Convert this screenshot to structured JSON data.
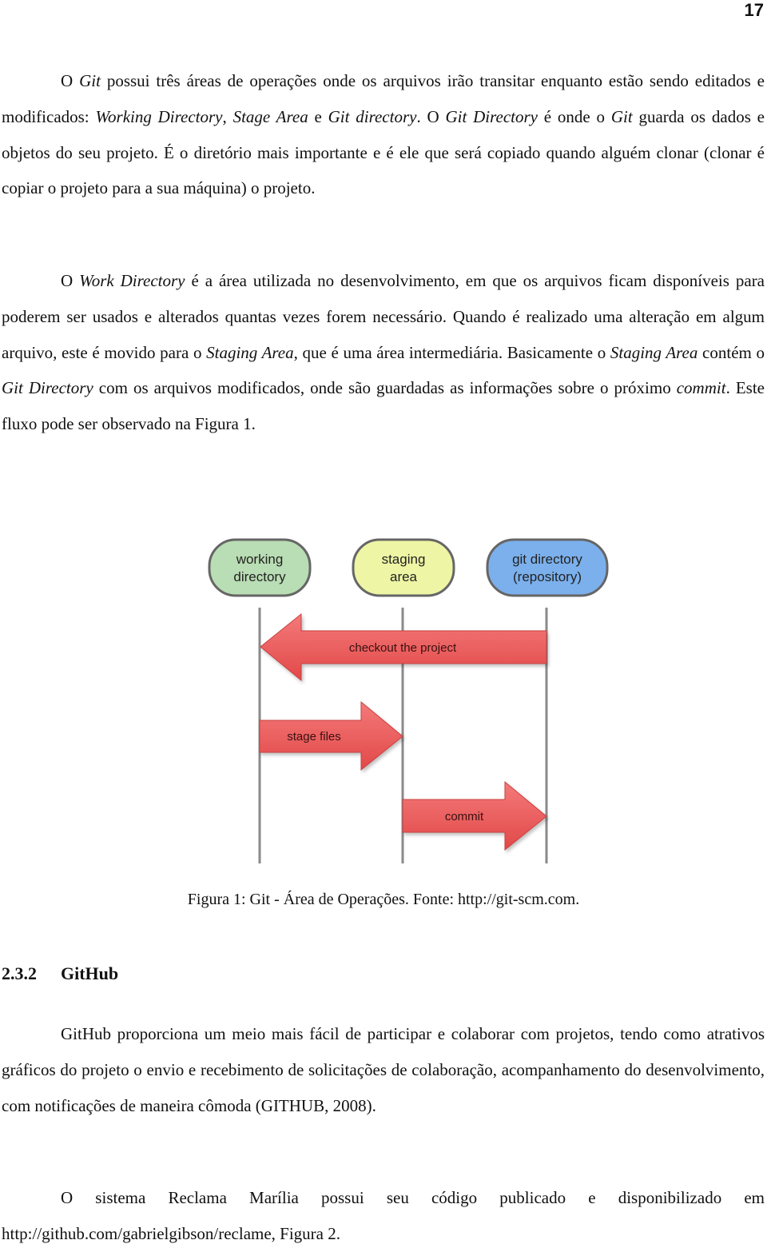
{
  "page": {
    "number": "17"
  },
  "paragraphs": {
    "p1": {
      "s1": "O ",
      "s2": "Git",
      "s3": " possui três áreas de operações onde os arquivos irão transitar enquanto estão sendo editados e modificados: ",
      "s4": "Working Directory",
      "s5": ", ",
      "s6": "Stage Area",
      "s7": " e ",
      "s8": "Git directory",
      "s9": ". O ",
      "s10": "Git Directory",
      "s11": " é onde o ",
      "s12": "Git",
      "s13": " guarda os dados e objetos do seu projeto. É o diretório mais importante e é ele que será copiado quando alguém clonar (clonar é copiar o projeto para a sua máquina) o projeto."
    },
    "p2": {
      "s1": "O ",
      "s2": "Work Directory",
      "s3": " é a área utilizada no desenvolvimento, em que os arquivos ficam disponíveis para poderem ser usados e alterados quantas vezes forem necessário. Quando é realizado uma alteração em algum arquivo, este é movido para o ",
      "s4": "Staging Area",
      "s5": ", que é uma área intermediária. Basicamente o ",
      "s6": "Staging Area",
      "s7": " contém o ",
      "s8": "Git Directory",
      "s9": " com os arquivos modificados, onde são guardadas as informações sobre o próximo ",
      "s10": "commit",
      "s11": ". Este fluxo pode ser observado na Figura 1."
    },
    "p3": "GitHub proporciona um meio mais fácil de participar e colaborar com projetos, tendo como atrativos gráficos do projeto o envio e recebimento de solicitações de colaboração, acompanhamento do desenvolvimento, com notificações de maneira cômoda (GITHUB, 2008).",
    "p4": "O sistema Reclama Marília possui seu código publicado e disponibilizado em http://github.com/gabrielgibson/reclame, Figura 2."
  },
  "figure": {
    "nodes": [
      {
        "line1": "working",
        "line2": "directory",
        "color": "#b9ddb4"
      },
      {
        "line1": "staging",
        "line2": "area",
        "color": "#eef5a4"
      },
      {
        "line1": "git directory",
        "line2": "(repository)",
        "color": "#7bb0ec"
      }
    ],
    "arrows": [
      {
        "label": "checkout the project",
        "direction": "left",
        "from": "git directory",
        "to": "working directory"
      },
      {
        "label": "stage files",
        "direction": "right",
        "from": "working directory",
        "to": "staging area"
      },
      {
        "label": "commit",
        "direction": "right",
        "from": "staging area",
        "to": "git directory"
      }
    ],
    "arrow_color": "#ee5a5a",
    "caption": "Figura 1: Git - Área de Operações. Fonte: http://git-scm.com."
  },
  "section": {
    "number": "2.3.2",
    "title": "GitHub"
  }
}
